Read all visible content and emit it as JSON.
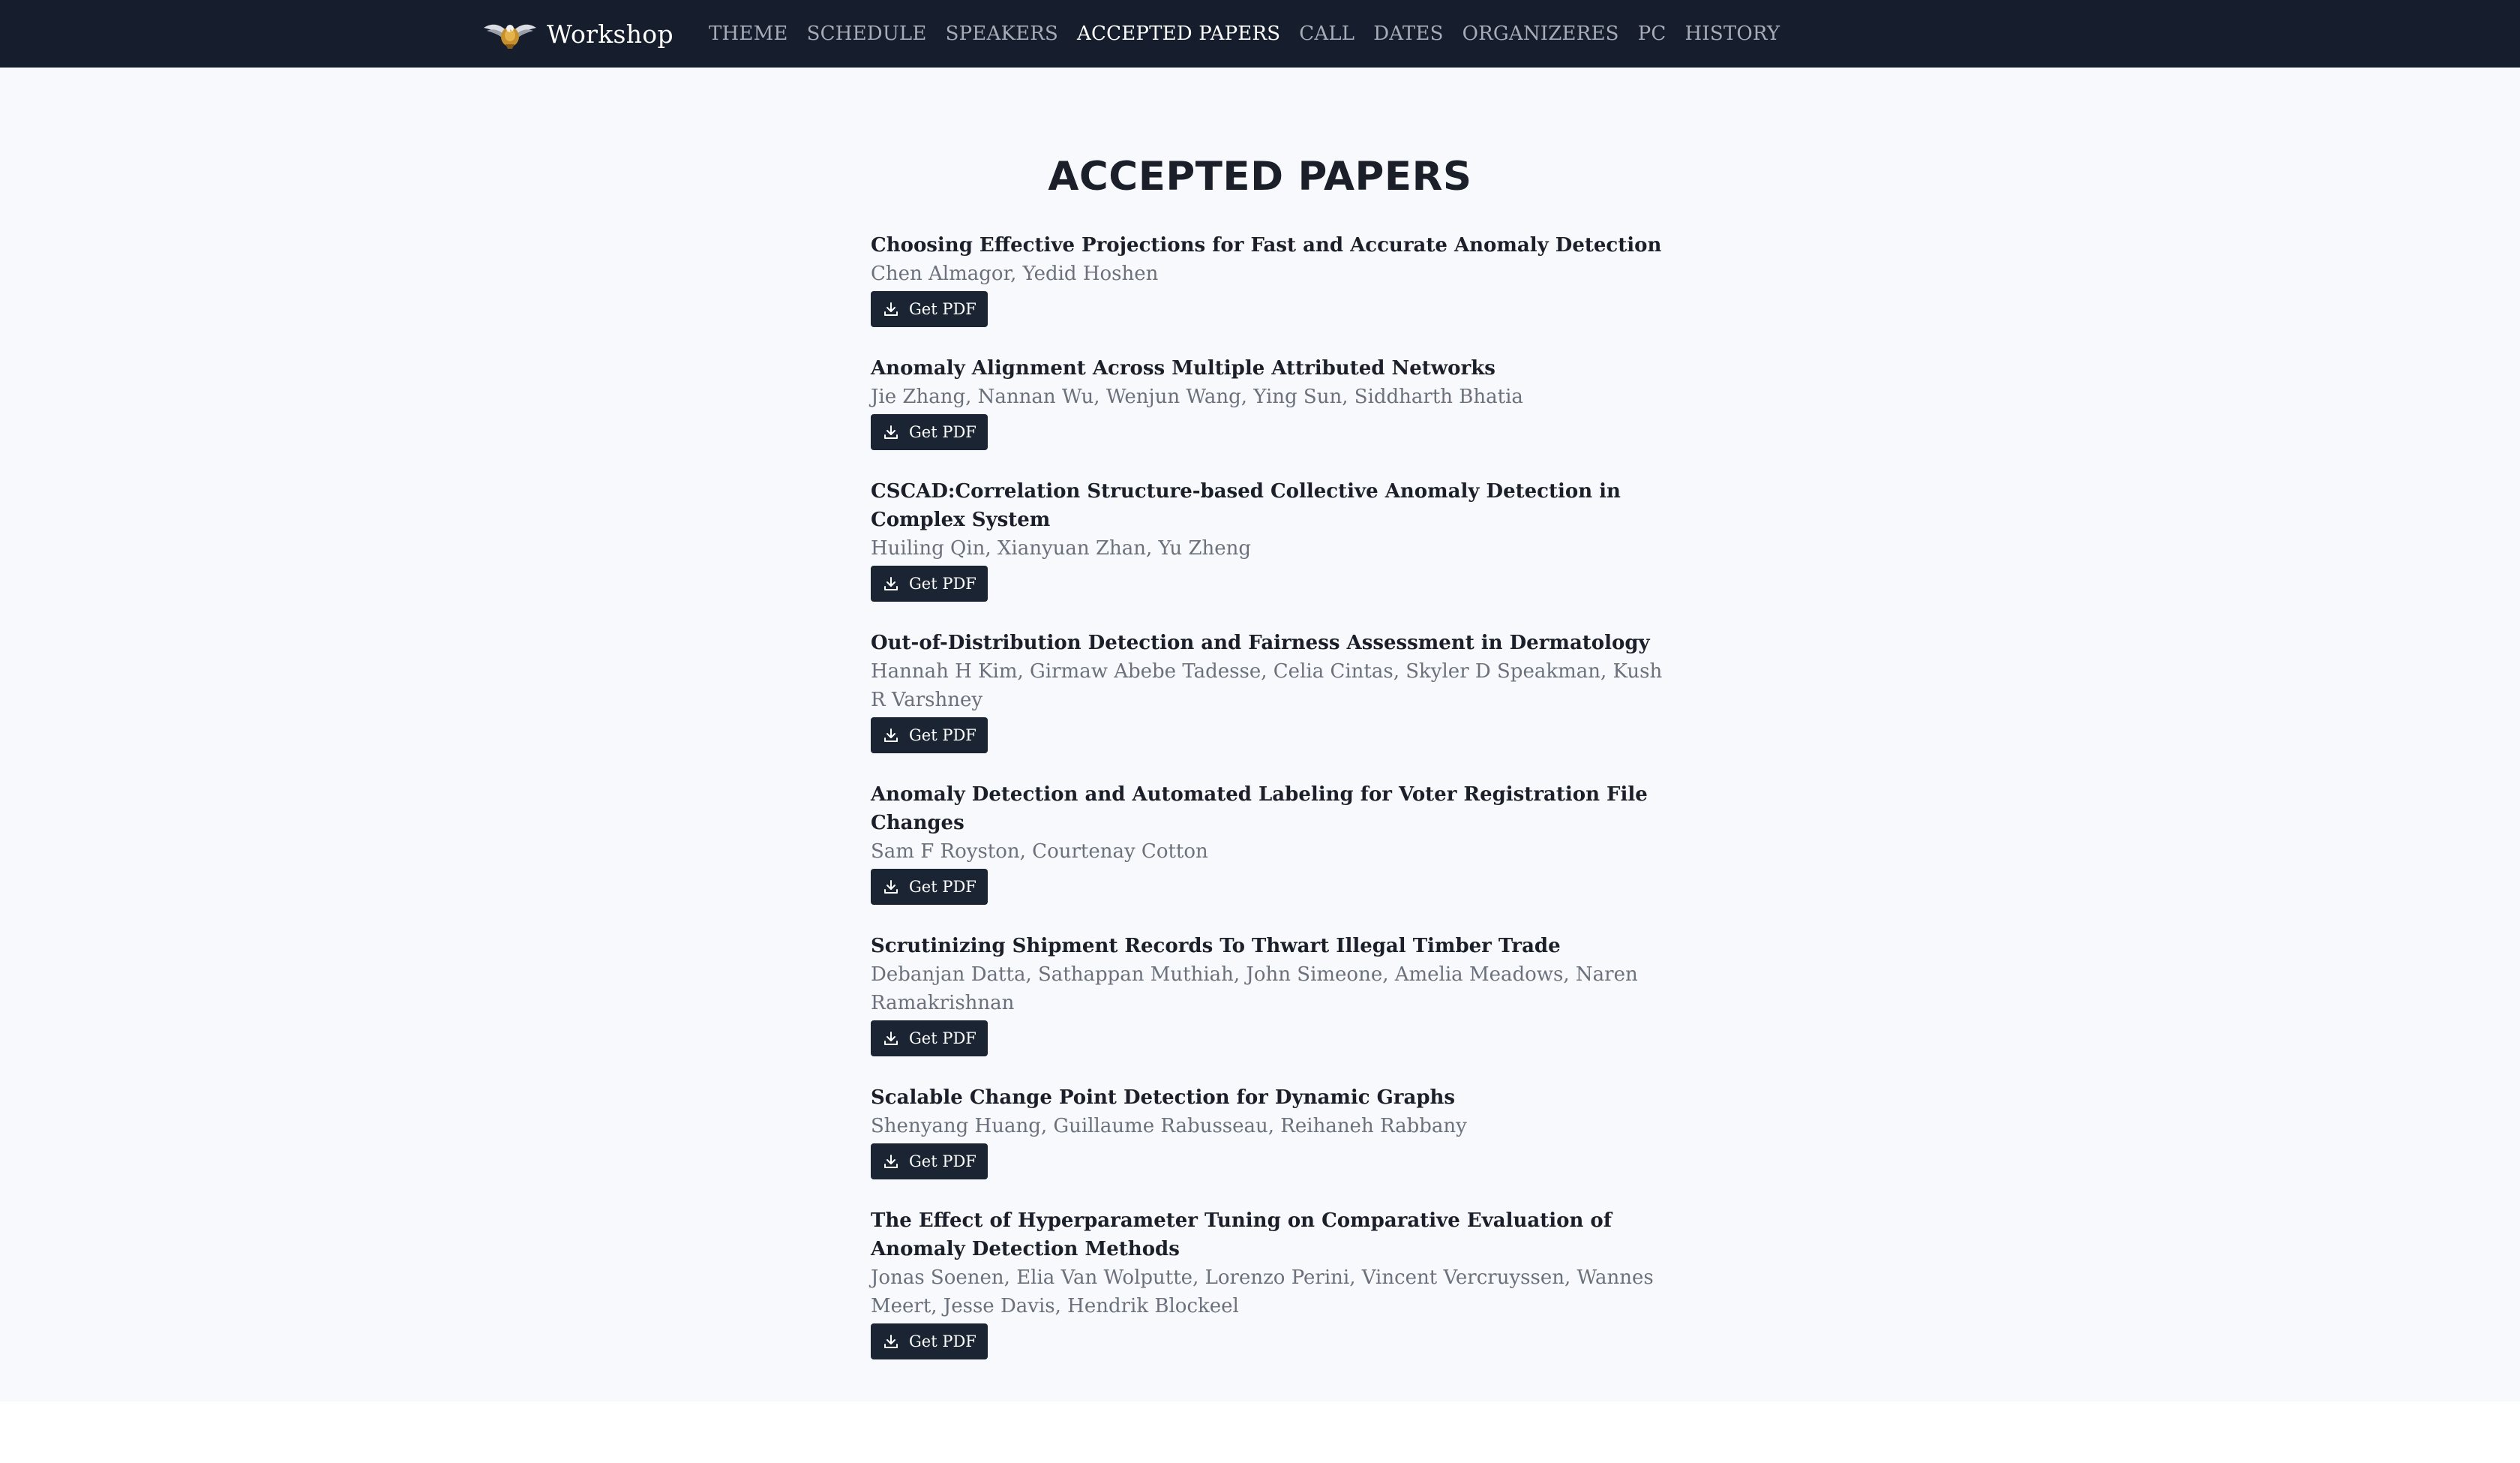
{
  "navbar": {
    "brand": "Workshop",
    "logo_icon": "eagle-emblem-icon",
    "links": [
      {
        "label": "THEME",
        "active": false
      },
      {
        "label": "SCHEDULE",
        "active": false
      },
      {
        "label": "SPEAKERS",
        "active": false
      },
      {
        "label": "ACCEPTED PAPERS",
        "active": true
      },
      {
        "label": "CALL",
        "active": false
      },
      {
        "label": "DATES",
        "active": false
      },
      {
        "label": "ORGANIZERES",
        "active": false
      },
      {
        "label": "PC",
        "active": false
      },
      {
        "label": "HISTORY",
        "active": false
      }
    ]
  },
  "main": {
    "title": "ACCEPTED PAPERS",
    "button_icon": "download-icon",
    "papers": [
      {
        "title": "Choosing Effective Projections for Fast and Accurate Anomaly Detection",
        "authors": "Chen Almagor, Yedid Hoshen",
        "button": "Get PDF"
      },
      {
        "title": "Anomaly Alignment Across Multiple Attributed Networks",
        "authors": "Jie Zhang, Nannan Wu, Wenjun Wang, Ying Sun, Siddharth Bhatia",
        "button": "Get PDF"
      },
      {
        "title": "CSCAD:Correlation Structure-based Collective Anomaly Detection in Complex System",
        "authors": "Huiling Qin, Xianyuan Zhan, Yu Zheng",
        "button": "Get PDF"
      },
      {
        "title": "Out-of-Distribution Detection and Fairness Assessment in Dermatology",
        "authors": "Hannah H Kim, Girmaw Abebe Tadesse, Celia Cintas, Skyler D Speakman, Kush R Varshney",
        "button": "Get PDF"
      },
      {
        "title": "Anomaly Detection and Automated Labeling for Voter Registration File Changes",
        "authors": "Sam F Royston, Courtenay Cotton",
        "button": "Get PDF"
      },
      {
        "title": "Scrutinizing Shipment Records To Thwart Illegal Timber Trade",
        "authors": "Debanjan Datta, Sathappan Muthiah, John Simeone, Amelia Meadows, Naren Ramakrishnan",
        "button": "Get PDF"
      },
      {
        "title": "Scalable Change Point Detection for Dynamic Graphs",
        "authors": "Shenyang Huang, Guillaume Rabusseau, Reihaneh Rabbany",
        "button": "Get PDF"
      },
      {
        "title": "The Effect of Hyperparameter Tuning on Comparative Evaluation of Anomaly Detection Methods",
        "authors": "Jonas Soenen, Elia Van Wolputte, Lorenzo Perini, Vincent Vercruyssen, Wannes Meert, Jesse Davis, Hendrik Blockeel",
        "button": "Get PDF"
      }
    ]
  }
}
